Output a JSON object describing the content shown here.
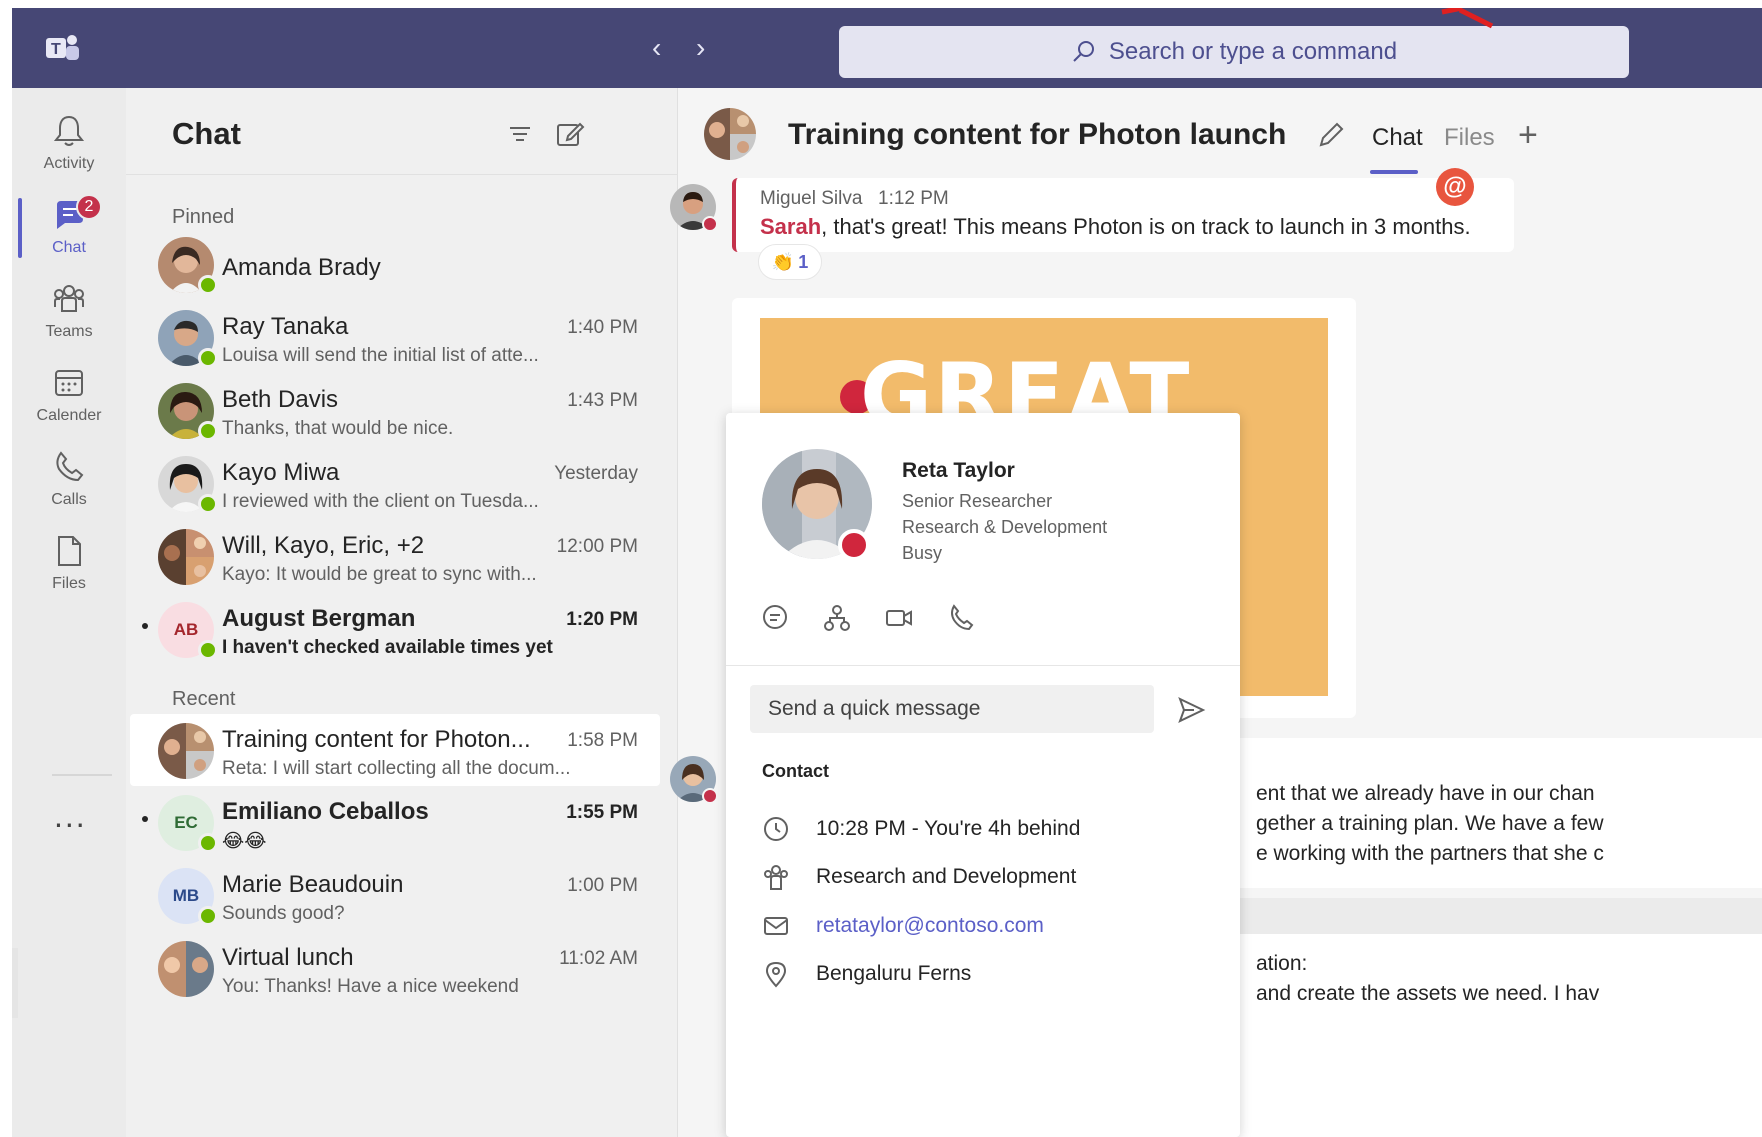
{
  "titlebar": {
    "search_placeholder": "Search or type a command",
    "back_icon": "chevron-left-icon",
    "forward_icon": "chevron-right-icon",
    "color": "#464775"
  },
  "rail": {
    "items": [
      {
        "label": "Activity",
        "icon": "bell-icon"
      },
      {
        "label": "Chat",
        "icon": "chat-icon",
        "badge": "2"
      },
      {
        "label": "Teams",
        "icon": "teams-icon"
      },
      {
        "label": "Calender",
        "icon": "calendar-icon"
      },
      {
        "label": "Calls",
        "icon": "phone-icon"
      },
      {
        "label": "Files",
        "icon": "file-icon"
      }
    ],
    "more": "..."
  },
  "chat_list": {
    "title": "Chat",
    "pinned_label": "Pinned",
    "recent_label": "Recent",
    "pinned": [
      {
        "name": "Amanda Brady",
        "time": "",
        "preview": ""
      },
      {
        "name": "Ray Tanaka",
        "time": "1:40 PM",
        "preview": "Louisa will send the initial list of atte..."
      },
      {
        "name": "Beth Davis",
        "time": "1:43 PM",
        "preview": "Thanks, that would be nice."
      },
      {
        "name": "Kayo Miwa",
        "time": "Yesterday",
        "preview": "I reviewed with the client on Tuesda..."
      },
      {
        "name": "Will, Kayo, Eric, +2",
        "time": "12:00 PM",
        "preview": "Kayo: It would be great to sync with..."
      },
      {
        "name": "August Bergman",
        "initials": "AB",
        "time": "1:20 PM",
        "preview": "I haven't checked available times yet"
      }
    ],
    "recent": [
      {
        "name": "Training content for Photon...",
        "time": "1:58 PM",
        "preview": "Reta: I will start collecting all the docum..."
      },
      {
        "name": "Emiliano Ceballos",
        "initials": "EC",
        "time": "1:55 PM",
        "preview": "😂😂"
      },
      {
        "name": "Marie Beaudouin",
        "initials": "MB",
        "time": "1:00 PM",
        "preview": "Sounds good?"
      },
      {
        "name": "Virtual lunch",
        "time": "11:02 AM",
        "preview": "You: Thanks! Have a nice weekend"
      }
    ]
  },
  "conversation": {
    "title": "Training content for Photon launch",
    "tabs": [
      "Chat",
      "Files"
    ],
    "add_tab": "+",
    "message1": {
      "author": "Miguel Silva",
      "time": "1:12 PM",
      "mention": "Sarah",
      "text": ", that's great! This means Photon is on track to launch in 3 months.",
      "reaction_count": "1"
    },
    "gif_text": "GREAT JOB",
    "message2_lines": [
      "ent that we already have in our chan",
      "gether a training plan. We have a few",
      "e working with the partners that she c"
    ],
    "message3_lines": [
      "ation:",
      "and create the assets we need. I hav"
    ]
  },
  "profile_card": {
    "name": "Reta Taylor",
    "title": "Senior Researcher",
    "department": "Research & Development",
    "status": "Busy",
    "quick_message_placeholder": "Send a quick message",
    "contact_heading": "Contact",
    "local_time": "10:28 PM - You're 4h behind",
    "org": "Research and Development",
    "email": "retataylor@contoso.com",
    "location": "Bengaluru Ferns"
  },
  "colors": {
    "accent": "#5b5fc7",
    "busy": "#c4314b",
    "available": "#6bb700",
    "gif_bg": "#f2bb6b"
  }
}
